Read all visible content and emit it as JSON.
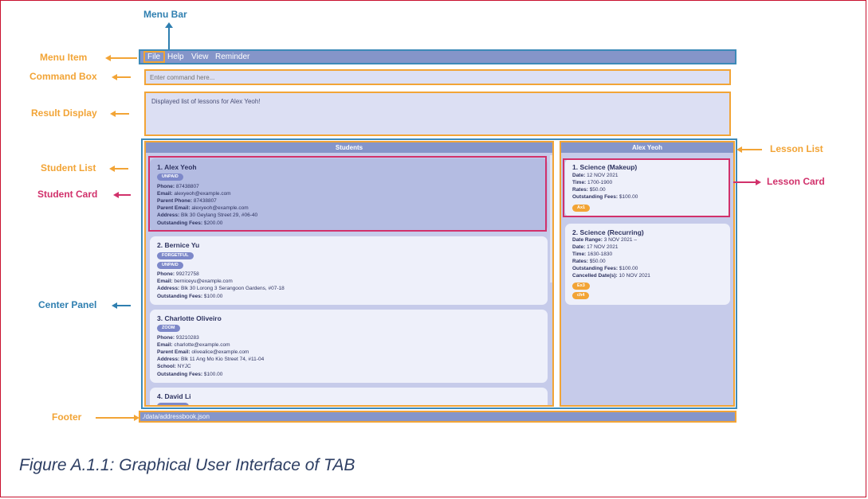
{
  "colors": {
    "accent": "#8595c9",
    "orange": "#f2a436",
    "blue": "#2f7fb0",
    "pink": "#d1316b"
  },
  "menu": {
    "items": [
      "File",
      "Help",
      "View",
      "Reminder"
    ]
  },
  "command_box": {
    "placeholder": "Enter command here..."
  },
  "result_display": {
    "text": "Displayed list of lessons for Alex Yeoh!"
  },
  "student_list": {
    "header": "Students",
    "students": [
      {
        "title": "1.  Alex Yeoh",
        "tags": [
          "UNPAID"
        ],
        "lines": [
          {
            "label": "Phone:",
            "value": "87438807"
          },
          {
            "label": "Email:",
            "value": "alexyeoh@example.com"
          },
          {
            "label": "Parent Phone:",
            "value": "87438807"
          },
          {
            "label": "Parent Email:",
            "value": "alexyeoh@example.com"
          },
          {
            "label": "Address:",
            "value": "Blk 30 Geylang Street 29, #06-40"
          },
          {
            "label": "Outstanding Fees:",
            "value": "$200.00"
          }
        ]
      },
      {
        "title": "2.  Bernice Yu",
        "tags": [
          "FORGETFUL",
          "UNPAID"
        ],
        "lines": [
          {
            "label": "Phone:",
            "value": "99272758"
          },
          {
            "label": "Email:",
            "value": "berniceyu@example.com"
          },
          {
            "label": "Address:",
            "value": "Blk 30 Lorong 3 Serangoon Gardens, #07-18"
          },
          {
            "label": "Outstanding Fees:",
            "value": "$100.00"
          }
        ]
      },
      {
        "title": "3.  Charlotte Oliveiro",
        "tags": [
          "ZOOM"
        ],
        "lines": [
          {
            "label": "Phone:",
            "value": "93210283"
          },
          {
            "label": "Email:",
            "value": "charlotte@example.com"
          },
          {
            "label": "Parent Email:",
            "value": "olivealice@example.com"
          },
          {
            "label": "Address:",
            "value": "Blk 11 Ang Mo Kio Street 74, #11-04"
          },
          {
            "label": "School:",
            "value": "NYJC"
          },
          {
            "label": "Outstanding Fees:",
            "value": "$100.00"
          }
        ]
      },
      {
        "title": "4.  David Li",
        "tags": [],
        "lines": []
      }
    ]
  },
  "lesson_list": {
    "header": "Alex Yeoh",
    "lessons": [
      {
        "title": "1.  Science (Makeup)",
        "lines": [
          {
            "label": "Date:",
            "value": "12 NOV 2021"
          },
          {
            "label": "Time:",
            "value": "1700-1900"
          },
          {
            "label": "Rates:",
            "value": "$50.00"
          },
          {
            "label": "Outstanding Fees:",
            "value": "$100.00"
          }
        ],
        "tags": [
          "Ax1"
        ]
      },
      {
        "title": "2.  Science (Recurring)",
        "lines": [
          {
            "label": "Date Range:",
            "value": "3 NOV 2021  –"
          },
          {
            "label": "Date:",
            "value": "17 NOV 2021"
          },
          {
            "label": "Time:",
            "value": "1630-1830"
          },
          {
            "label": "Rates:",
            "value": "$50.00"
          },
          {
            "label": "Outstanding Fees:",
            "value": "$100.00"
          },
          {
            "label": "Cancelled Date(s):",
            "value": "10 NOV 2021"
          }
        ],
        "tags": [
          "Ex3",
          "ch4"
        ]
      }
    ]
  },
  "footer": {
    "path": "./data/addressbook.json"
  },
  "annotations": {
    "menu_bar": "Menu Bar",
    "menu_item": "Menu Item",
    "command_box": "Command Box",
    "result_display": "Result Display",
    "student_list": "Student List",
    "student_card": "Student Card",
    "center_panel": "Center Panel",
    "footer": "Footer",
    "lesson_list": "Lesson List",
    "lesson_card": "Lesson Card"
  },
  "caption": "Figure A.1.1: Graphical User Interface of TAB"
}
